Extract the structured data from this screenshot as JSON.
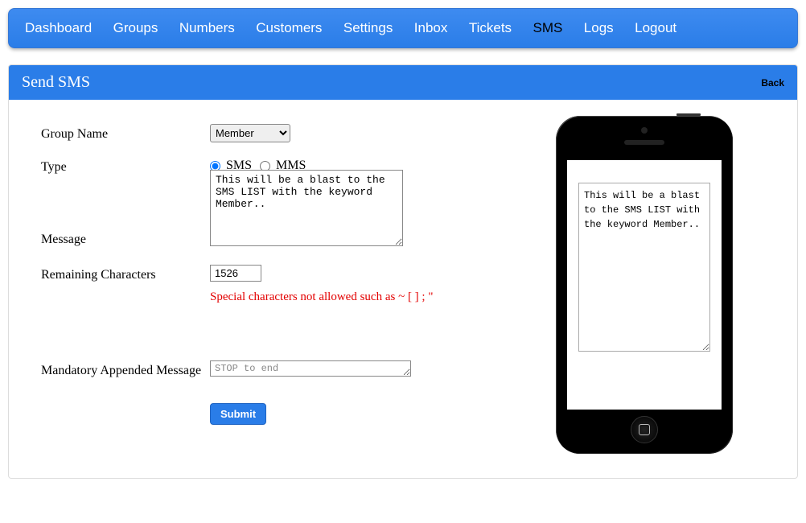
{
  "nav": {
    "items": [
      {
        "label": "Dashboard",
        "active": false
      },
      {
        "label": "Groups",
        "active": false
      },
      {
        "label": "Numbers",
        "active": false
      },
      {
        "label": "Customers",
        "active": false
      },
      {
        "label": "Settings",
        "active": false
      },
      {
        "label": "Inbox",
        "active": false
      },
      {
        "label": "Tickets",
        "active": false
      },
      {
        "label": "SMS",
        "active": true
      },
      {
        "label": "Logs",
        "active": false
      },
      {
        "label": "Logout",
        "active": false
      }
    ]
  },
  "panel": {
    "title": "Send SMS",
    "back_label": "Back"
  },
  "form": {
    "group_name_label": "Group Name",
    "group_name_value": "Member",
    "type_label": "Type",
    "type_options": {
      "sms": "SMS",
      "mms": "MMS"
    },
    "type_selected": "sms",
    "message_label": "Message",
    "message_value": "This will be a blast to the SMS LIST with the keyword Member..",
    "remaining_label": "Remaining Characters",
    "remaining_value": "1526",
    "warning_text": "Special characters not allowed such as ~ [ ] ; \"",
    "appended_label": "Mandatory Appended Message",
    "appended_value": "STOP to end",
    "submit_label": "Submit"
  },
  "preview": {
    "text": "This will be a blast to the SMS LIST with the keyword Member.."
  }
}
